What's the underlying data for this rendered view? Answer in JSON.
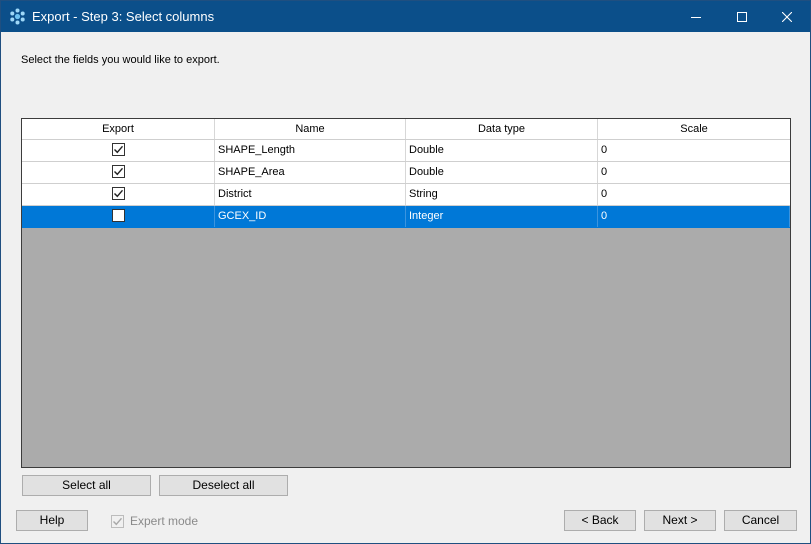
{
  "window": {
    "title": "Export - Step 3: Select columns",
    "icon": "app-logo-icon",
    "controls": [
      "minimize-icon",
      "maximize-icon",
      "close-icon"
    ],
    "titlebar_color": "#0b4f8a"
  },
  "instructions": "Select the fields you would like to export.",
  "grid": {
    "columns": [
      "Export",
      "Name",
      "Data type",
      "Scale"
    ],
    "rows": [
      {
        "export": true,
        "name": "SHAPE_Length",
        "type": "Double",
        "scale": "0",
        "selected": false
      },
      {
        "export": true,
        "name": "SHAPE_Area",
        "type": "Double",
        "scale": "0",
        "selected": false
      },
      {
        "export": true,
        "name": "District",
        "type": "String",
        "scale": "0",
        "selected": false
      },
      {
        "export": false,
        "name": "GCEX_ID",
        "type": "Integer",
        "scale": "0",
        "selected": true
      }
    ],
    "selection_color": "#0078d7"
  },
  "buttons": {
    "select_all": "Select all",
    "deselect_all": "Deselect all",
    "help": "Help",
    "back": "< Back",
    "next": "Next >",
    "cancel": "Cancel"
  },
  "expert_mode": {
    "label": "Expert mode",
    "checked": true,
    "disabled": true
  }
}
